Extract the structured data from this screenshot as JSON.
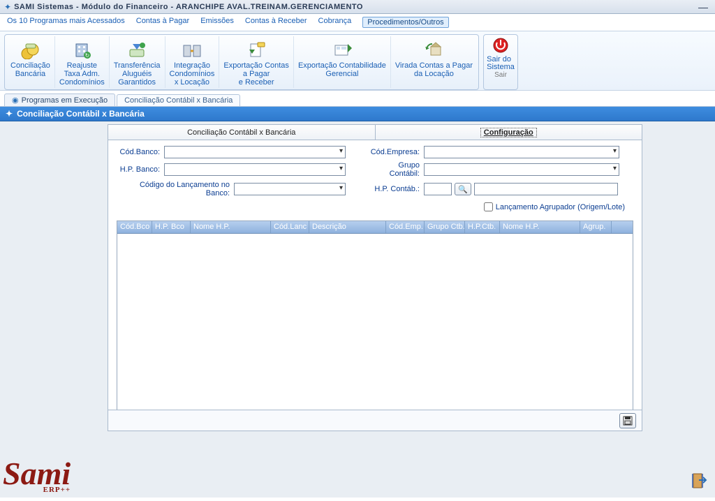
{
  "window": {
    "title": "SAMI Sistemas - Módulo do Financeiro - ARANCHIPE AVAL.TREINAM.GERENCIAMENTO"
  },
  "menubar": {
    "items": [
      "Os 10 Programas mais Acessados",
      "Contas à Pagar",
      "Emissões",
      "Contas à Receber",
      "Cobrança",
      "Procedimentos/Outros"
    ],
    "active_index": 5
  },
  "toolbar": {
    "buttons": [
      {
        "label": "Conciliação\nBancária"
      },
      {
        "label": "Reajuste\nTaxa Adm.\nCondomínios"
      },
      {
        "label": "Transferência\nAluguéis\nGarantidos"
      },
      {
        "label": "Integração\nCondomínios\nx Locação"
      },
      {
        "label": "Exportação Contas\na Pagar\ne Receber"
      },
      {
        "label": "Exportação Contabilidade\nGerencial"
      },
      {
        "label": "Virada Contas a Pagar\nda Locação"
      }
    ],
    "exit": {
      "label": "Sair do\nSistema",
      "caption": "Sair"
    }
  },
  "doc_tabs": {
    "items": [
      "Programas em Execução",
      "Conciliação Contábil x Bancária"
    ],
    "active_index": 1
  },
  "subheader": {
    "title": "Conciliação Contábil x Bancária"
  },
  "panel": {
    "tabs": [
      "Conciliação Contábil x Bancária",
      "Configuração"
    ],
    "active_index": 1,
    "form": {
      "cod_banco_label": "Cód.Banco:",
      "cod_banco_value": "",
      "hp_banco_label": "H.P. Banco:",
      "hp_banco_value": "",
      "cod_lanc_label": "Código do Lançamento no Banco:",
      "cod_lanc_value": "",
      "cod_empresa_label": "Cód.Empresa:",
      "cod_empresa_value": "",
      "grupo_contabil_label": "Grupo Contábil:",
      "grupo_contabil_value": "",
      "hp_contab_label": "H.P. Contáb.:",
      "hp_contab_value": "",
      "hp_contab_desc": "",
      "agrupador_label": "Lançamento Agrupador (Origem/Lote)",
      "agrupador_checked": false
    },
    "grid": {
      "columns": [
        "Cód.Bco",
        "H.P. Bco",
        "Nome H.P.",
        "Cód.Lanc",
        "Descrição",
        "Cód.Emp.",
        "Grupo Ctb.",
        "H.P.Ctb.",
        "Nome H.P.",
        "Agrup."
      ],
      "rows": []
    }
  },
  "logo": {
    "main": "Sami",
    "sub": "ERP++"
  }
}
